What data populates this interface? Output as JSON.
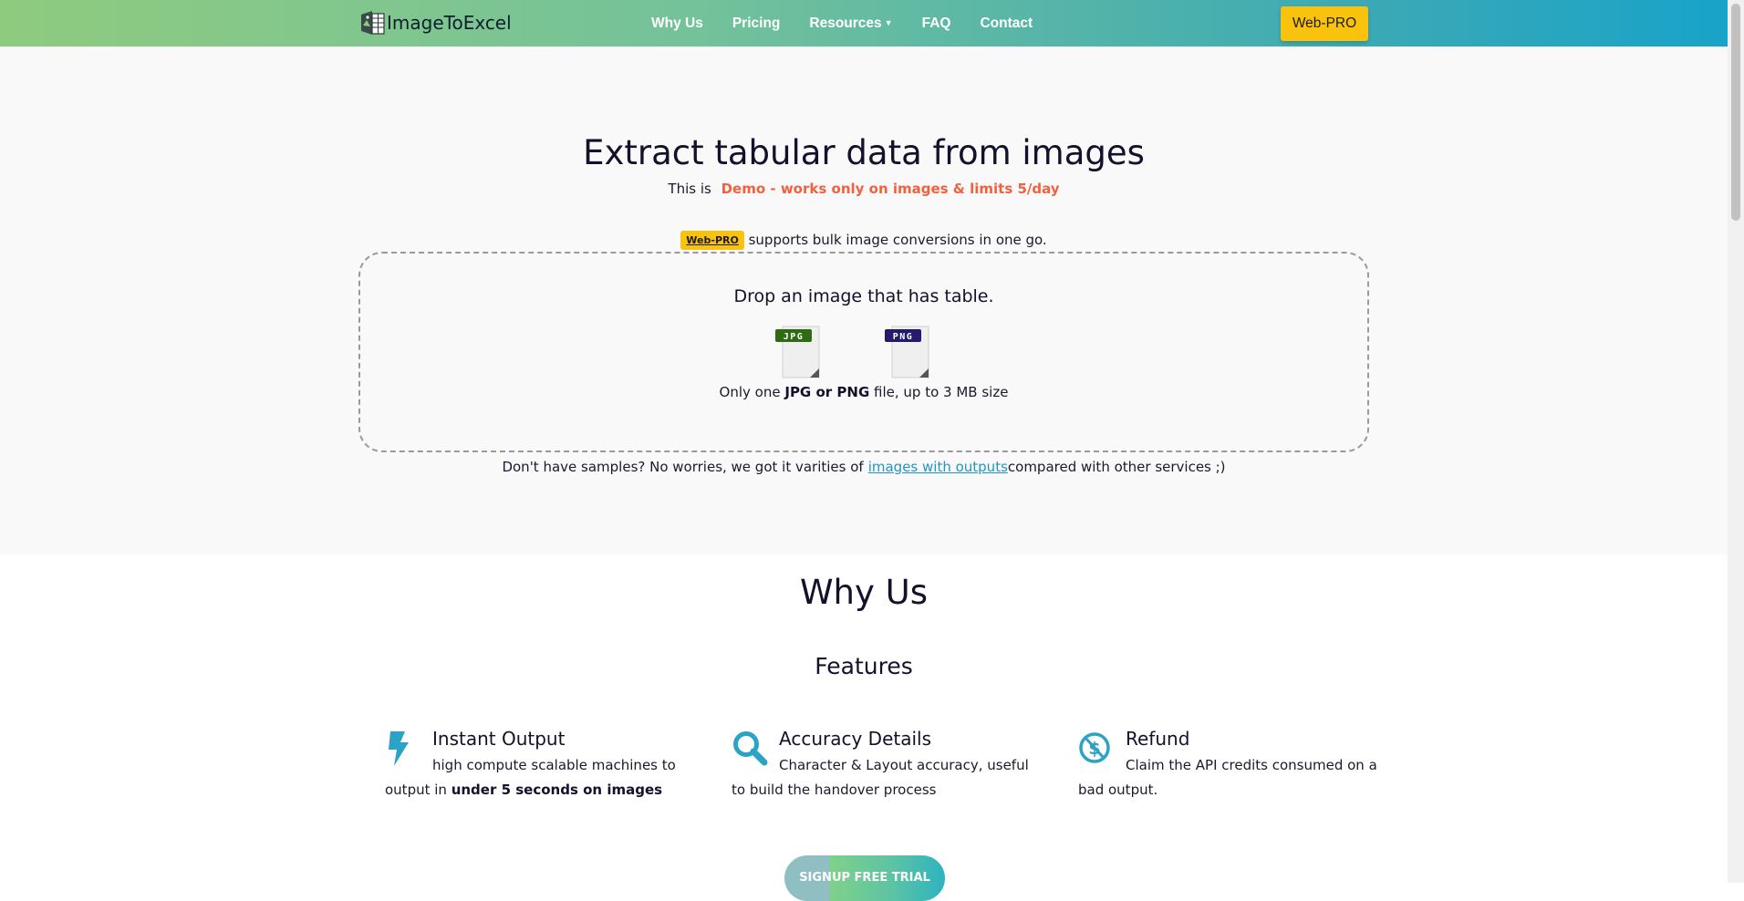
{
  "nav": {
    "logo_text": "ImageToExcel",
    "links": [
      "Why Us",
      "Pricing",
      "Resources",
      "FAQ",
      "Contact"
    ],
    "pro_button": "Web-PRO"
  },
  "hero": {
    "title": "Extract tabular data from images",
    "sub_prefix": "This is",
    "sub_demo": "Demo - works only on images & limits 5/day",
    "pro_badge": "Web-PRO",
    "bulk_text": "supports bulk image conversions in one go.",
    "drop_title": "Drop an image that has table.",
    "jpg_label": "JPG",
    "png_label": "PNG",
    "note_prefix": "Only one",
    "note_bold": "JPG or PNG",
    "note_suffix": "file, up to 3 MB size",
    "samples_prefix": "Don't have samples? No worries, we got it varities of",
    "samples_link": "images with outputs",
    "samples_suffix": "compared with other services ;)"
  },
  "why": {
    "title": "Why Us",
    "features_title": "Features",
    "features": [
      {
        "icon": "lightning-icon",
        "title": "Instant Output",
        "desc": "high compute scalable machines to output in",
        "bold": "under 5 seconds on images"
      },
      {
        "icon": "magnifier-icon",
        "title": "Accuracy Details",
        "desc": "Character & Layout accuracy, useful to build the handover process",
        "bold": ""
      },
      {
        "icon": "no-dollar-icon",
        "title": "Refund",
        "desc": "Claim the API credits consumed on a bad output.",
        "bold": ""
      }
    ],
    "signup": "SIGNUP FREE TRIAL"
  },
  "colors": {
    "accent": "#2ba3c4",
    "demo": "#f2613f",
    "pro": "#f9c20c"
  }
}
